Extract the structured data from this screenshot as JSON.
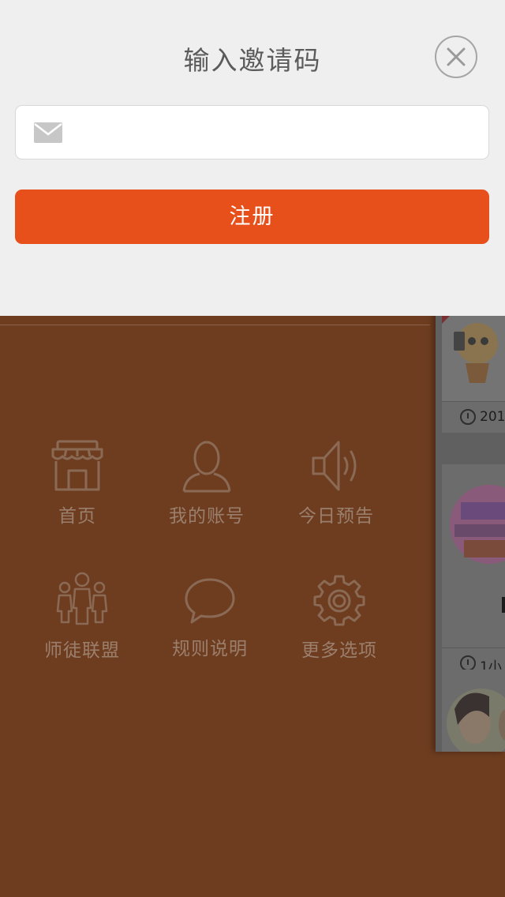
{
  "dialog": {
    "title": "输入邀请码",
    "close_icon": "close-icon",
    "input": {
      "icon": "mail-icon",
      "value": "",
      "placeholder": ""
    },
    "submit_label": "注册",
    "accent_color": "#e8501b"
  },
  "menu": {
    "items": [
      {
        "label": "首页",
        "icon": "store-icon"
      },
      {
        "label": "我的账号",
        "icon": "user-icon"
      },
      {
        "label": "今日预告",
        "icon": "speaker-icon"
      },
      {
        "label": "师徒联盟",
        "icon": "group-icon"
      },
      {
        "label": "规则说明",
        "icon": "chat-bubble-icon"
      },
      {
        "label": "更多选项",
        "icon": "gear-icon"
      }
    ],
    "background_color": "#6e3d20"
  },
  "content_peek": {
    "cards": [
      {
        "time_text": "201"
      },
      {
        "time_text": "1小"
      },
      {
        "time_text": ""
      }
    ]
  }
}
